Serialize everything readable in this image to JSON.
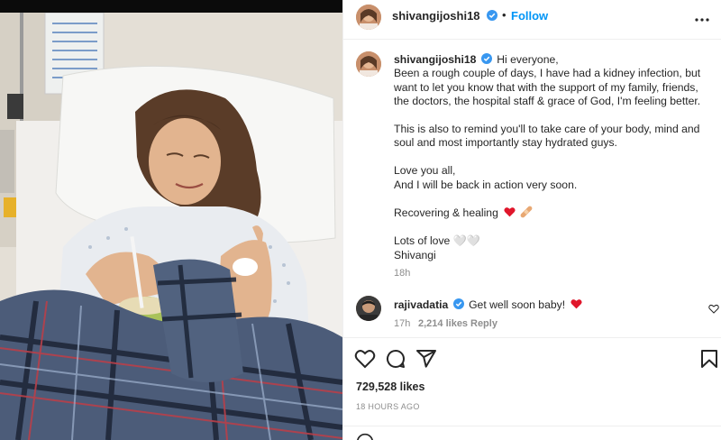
{
  "post": {
    "author": "shivangijoshi18",
    "follow_label": "Follow",
    "separator": "•",
    "caption": {
      "greeting": "Hi everyone,",
      "line1": "Been a rough couple of days, I have had a kidney infection, but",
      "line2": "want to let you know that with the support of my family, friends,",
      "line3": "the doctors, the hospital staff & grace of God, I'm feeling better.",
      "line4": "This is also to remind you'll to take care of your body, mind and",
      "line5": "soul and most importantly stay hydrated guys.",
      "line6": "Love you all,",
      "line7": "And I will be back in action very soon.",
      "line8": "Recovering & healing",
      "line9": "Lots of love 🤍🤍",
      "line10": "Shivangi",
      "time": "18h"
    },
    "comment": {
      "author": "rajivadatia",
      "text": "Get well soon baby!",
      "time": "17h",
      "likes": "2,214 likes",
      "reply_label": "Reply"
    },
    "likes_label": "729,528 likes",
    "posted_label": "18 HOURS AGO"
  },
  "icons": {
    "heart": "heart-icon",
    "comment": "comment-icon",
    "share": "share-icon",
    "save": "bookmark-icon",
    "more": "more-icon",
    "verified": "verified-icon"
  },
  "colors": {
    "link": "#0095f6",
    "text": "#262626",
    "muted": "#8e8e8e",
    "heart_red": "#ed4956"
  }
}
